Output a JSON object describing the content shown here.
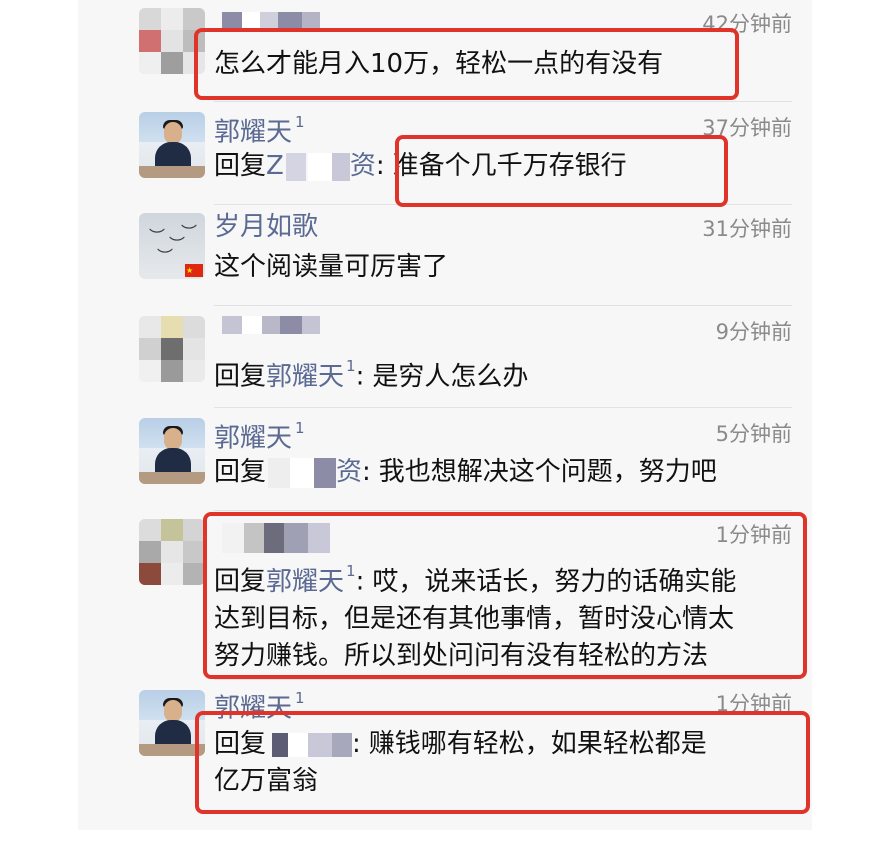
{
  "colors": {
    "name": "#5b6a92",
    "timestamp": "#8a8a8a",
    "body_text": "#111111",
    "highlight_box": "#e0342b",
    "panel_background": "#f7f7f7"
  },
  "comments": [
    {
      "author": "",
      "time": "42分钟前",
      "text": "怎么才能月入10万，轻松一点的有没有",
      "avatar": "pixelated-avatar",
      "highlighted": true
    },
    {
      "author": "郭耀天",
      "author_badge": "1",
      "time": "37分钟前",
      "reply_prefix": "回复",
      "reply_to_visible_start": "Z",
      "reply_to_visible_end": "资",
      "text": "准备个几千万存银行",
      "avatar": "man-in-suit-photo",
      "highlighted": true
    },
    {
      "author": "岁月如歌",
      "time": "31分钟前",
      "text": "这个阅读量可厉害了",
      "avatar": "birds-photo"
    },
    {
      "author": "",
      "time": "9分钟前",
      "reply_prefix": "回复",
      "reply_to": "郭耀天",
      "reply_to_badge": "1",
      "text": "是穷人怎么办",
      "avatar": "pixelated-avatar"
    },
    {
      "author": "郭耀天",
      "author_badge": "1",
      "time": "5分钟前",
      "reply_prefix": "回复",
      "reply_to_visible_end": "资",
      "text": "我也想解决这个问题，努力吧",
      "avatar": "man-in-suit-photo"
    },
    {
      "author": "",
      "time": "1分钟前",
      "reply_prefix": "回复",
      "reply_to": "郭耀天",
      "reply_to_badge": "1",
      "text_lines": [
        "哎，说来话长，努力的话确实能",
        "达到目标，但是还有其他事情，暂时没心情太",
        "努力赚钱。所以到处问问有没有轻松的方法"
      ],
      "avatar": "pixelated-avatar",
      "highlighted": true
    },
    {
      "author": "郭耀天",
      "author_badge": "1",
      "time": "1分钟前",
      "reply_prefix": "回复",
      "text_lines": [
        "赚钱哪有轻松，如果轻松都是",
        "亿万富翁"
      ],
      "avatar": "man-in-suit-photo",
      "highlighted": true
    }
  ]
}
